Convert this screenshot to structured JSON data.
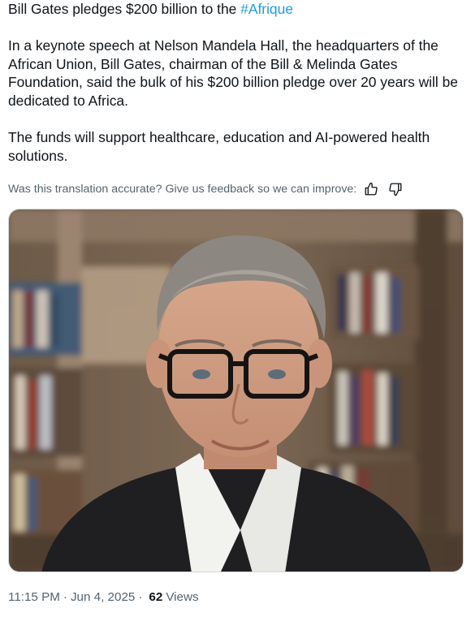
{
  "tweet": {
    "headline_prefix": "Bill Gates pledges $200 billion to the ",
    "hashtag": "#Afrique",
    "paragraph_1": "In a keynote speech at Nelson Mandela Hall, the headquarters of the African Union, Bill Gates, chairman of the Bill & Melinda Gates Foundation, said the bulk of his $200 billion pledge over 20 years will be dedicated to Africa.",
    "paragraph_2": "The funds will support healthcare, education and AI-powered health solutions."
  },
  "translation_feedback": {
    "prompt": "Was this translation accurate? Give us feedback so we can improve:",
    "thumbs_up_icon": "thumbs-up-icon",
    "thumbs_down_icon": "thumbs-down-icon"
  },
  "media": {
    "subject": "portrait photo of Bill Gates in front of bookshelves"
  },
  "meta": {
    "time": "11:15 PM",
    "separator": "·",
    "date": "Jun 4, 2025",
    "views_count": "62",
    "views_label": "Views"
  },
  "colors": {
    "text": "#0f1419",
    "secondary": "#536471",
    "link": "#1d9bf0",
    "border": "#cfd9de"
  }
}
